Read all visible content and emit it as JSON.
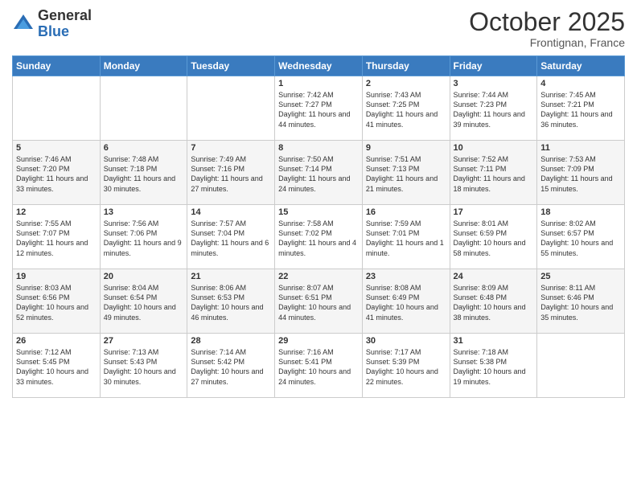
{
  "logo": {
    "general": "General",
    "blue": "Blue"
  },
  "header": {
    "month": "October 2025",
    "location": "Frontignan, France"
  },
  "weekdays": [
    "Sunday",
    "Monday",
    "Tuesday",
    "Wednesday",
    "Thursday",
    "Friday",
    "Saturday"
  ],
  "weeks": [
    [
      {
        "day": "",
        "info": ""
      },
      {
        "day": "",
        "info": ""
      },
      {
        "day": "",
        "info": ""
      },
      {
        "day": "1",
        "info": "Sunrise: 7:42 AM\nSunset: 7:27 PM\nDaylight: 11 hours and 44 minutes."
      },
      {
        "day": "2",
        "info": "Sunrise: 7:43 AM\nSunset: 7:25 PM\nDaylight: 11 hours and 41 minutes."
      },
      {
        "day": "3",
        "info": "Sunrise: 7:44 AM\nSunset: 7:23 PM\nDaylight: 11 hours and 39 minutes."
      },
      {
        "day": "4",
        "info": "Sunrise: 7:45 AM\nSunset: 7:21 PM\nDaylight: 11 hours and 36 minutes."
      }
    ],
    [
      {
        "day": "5",
        "info": "Sunrise: 7:46 AM\nSunset: 7:20 PM\nDaylight: 11 hours and 33 minutes."
      },
      {
        "day": "6",
        "info": "Sunrise: 7:48 AM\nSunset: 7:18 PM\nDaylight: 11 hours and 30 minutes."
      },
      {
        "day": "7",
        "info": "Sunrise: 7:49 AM\nSunset: 7:16 PM\nDaylight: 11 hours and 27 minutes."
      },
      {
        "day": "8",
        "info": "Sunrise: 7:50 AM\nSunset: 7:14 PM\nDaylight: 11 hours and 24 minutes."
      },
      {
        "day": "9",
        "info": "Sunrise: 7:51 AM\nSunset: 7:13 PM\nDaylight: 11 hours and 21 minutes."
      },
      {
        "day": "10",
        "info": "Sunrise: 7:52 AM\nSunset: 7:11 PM\nDaylight: 11 hours and 18 minutes."
      },
      {
        "day": "11",
        "info": "Sunrise: 7:53 AM\nSunset: 7:09 PM\nDaylight: 11 hours and 15 minutes."
      }
    ],
    [
      {
        "day": "12",
        "info": "Sunrise: 7:55 AM\nSunset: 7:07 PM\nDaylight: 11 hours and 12 minutes."
      },
      {
        "day": "13",
        "info": "Sunrise: 7:56 AM\nSunset: 7:06 PM\nDaylight: 11 hours and 9 minutes."
      },
      {
        "day": "14",
        "info": "Sunrise: 7:57 AM\nSunset: 7:04 PM\nDaylight: 11 hours and 6 minutes."
      },
      {
        "day": "15",
        "info": "Sunrise: 7:58 AM\nSunset: 7:02 PM\nDaylight: 11 hours and 4 minutes."
      },
      {
        "day": "16",
        "info": "Sunrise: 7:59 AM\nSunset: 7:01 PM\nDaylight: 11 hours and 1 minute."
      },
      {
        "day": "17",
        "info": "Sunrise: 8:01 AM\nSunset: 6:59 PM\nDaylight: 10 hours and 58 minutes."
      },
      {
        "day": "18",
        "info": "Sunrise: 8:02 AM\nSunset: 6:57 PM\nDaylight: 10 hours and 55 minutes."
      }
    ],
    [
      {
        "day": "19",
        "info": "Sunrise: 8:03 AM\nSunset: 6:56 PM\nDaylight: 10 hours and 52 minutes."
      },
      {
        "day": "20",
        "info": "Sunrise: 8:04 AM\nSunset: 6:54 PM\nDaylight: 10 hours and 49 minutes."
      },
      {
        "day": "21",
        "info": "Sunrise: 8:06 AM\nSunset: 6:53 PM\nDaylight: 10 hours and 46 minutes."
      },
      {
        "day": "22",
        "info": "Sunrise: 8:07 AM\nSunset: 6:51 PM\nDaylight: 10 hours and 44 minutes."
      },
      {
        "day": "23",
        "info": "Sunrise: 8:08 AM\nSunset: 6:49 PM\nDaylight: 10 hours and 41 minutes."
      },
      {
        "day": "24",
        "info": "Sunrise: 8:09 AM\nSunset: 6:48 PM\nDaylight: 10 hours and 38 minutes."
      },
      {
        "day": "25",
        "info": "Sunrise: 8:11 AM\nSunset: 6:46 PM\nDaylight: 10 hours and 35 minutes."
      }
    ],
    [
      {
        "day": "26",
        "info": "Sunrise: 7:12 AM\nSunset: 5:45 PM\nDaylight: 10 hours and 33 minutes."
      },
      {
        "day": "27",
        "info": "Sunrise: 7:13 AM\nSunset: 5:43 PM\nDaylight: 10 hours and 30 minutes."
      },
      {
        "day": "28",
        "info": "Sunrise: 7:14 AM\nSunset: 5:42 PM\nDaylight: 10 hours and 27 minutes."
      },
      {
        "day": "29",
        "info": "Sunrise: 7:16 AM\nSunset: 5:41 PM\nDaylight: 10 hours and 24 minutes."
      },
      {
        "day": "30",
        "info": "Sunrise: 7:17 AM\nSunset: 5:39 PM\nDaylight: 10 hours and 22 minutes."
      },
      {
        "day": "31",
        "info": "Sunrise: 7:18 AM\nSunset: 5:38 PM\nDaylight: 10 hours and 19 minutes."
      },
      {
        "day": "",
        "info": ""
      }
    ]
  ]
}
